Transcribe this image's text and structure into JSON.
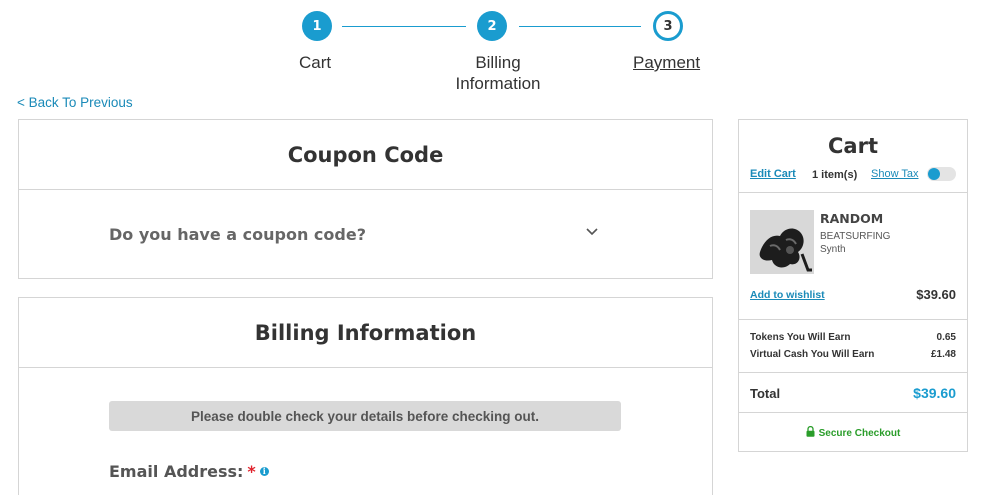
{
  "stepper": {
    "steps": [
      {
        "number": "1",
        "label": "Cart"
      },
      {
        "number": "2",
        "label": "Billing Information"
      },
      {
        "number": "3",
        "label": "Payment"
      }
    ],
    "active_step": 3
  },
  "nav": {
    "back_link": "< Back To Previous"
  },
  "coupon": {
    "title": "Coupon Code",
    "question": "Do you have a coupon code?"
  },
  "billing": {
    "title": "Billing Information",
    "notice": "Please double check your details before checking out.",
    "email_label": "Email Address:",
    "required_marker": "*"
  },
  "cart": {
    "title": "Cart",
    "edit_link": "Edit Cart",
    "items_count": "1 item(s)",
    "show_tax_label": "Show Tax",
    "item": {
      "name": "RANDOM",
      "brand": "BEATSURFING",
      "category": "Synth",
      "wishlist_link": "Add to wishlist",
      "price": "$39.60"
    },
    "earnings": [
      {
        "label": "Tokens You Will Earn",
        "value": "0.65"
      },
      {
        "label": "Virtual Cash You Will Earn",
        "value": "£1.48"
      }
    ],
    "total_label": "Total",
    "total_value": "$39.60",
    "secure_label": "Secure Checkout"
  },
  "colors": {
    "accent": "#1a9ccf",
    "link": "#1a8ab8",
    "required": "#e0242e",
    "secure": "#2a9d2a"
  },
  "icons": [
    "chevron-down-icon",
    "info-icon",
    "lock-icon"
  ]
}
